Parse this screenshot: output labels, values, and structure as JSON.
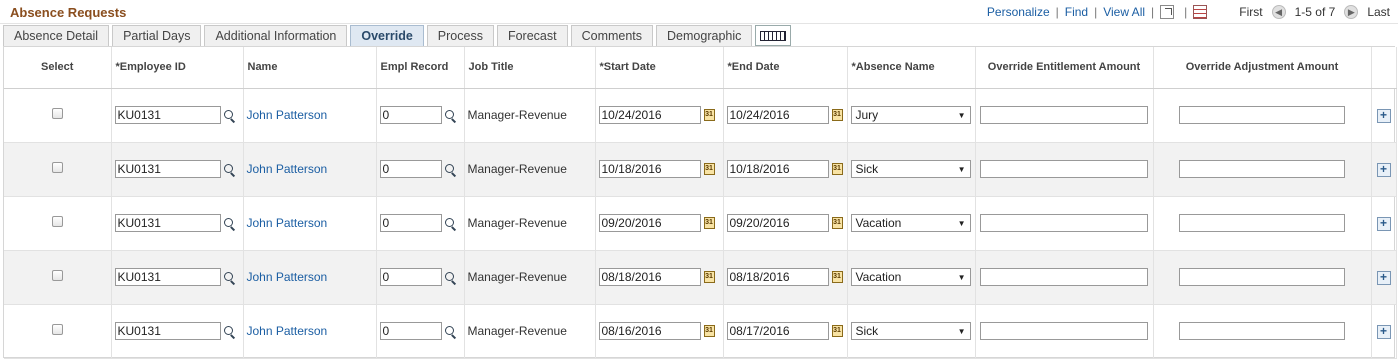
{
  "grid": {
    "title": "Absence Requests",
    "nav": {
      "personalize": "Personalize",
      "find": "Find",
      "view_all": "View All",
      "first": "First",
      "range": "1-5 of 7",
      "last": "Last"
    }
  },
  "tabs": [
    {
      "label": "Absence Detail",
      "active": false
    },
    {
      "label": "Partial Days",
      "active": false
    },
    {
      "label": "Additional Information",
      "active": false
    },
    {
      "label": "Override",
      "active": true
    },
    {
      "label": "Process",
      "active": false
    },
    {
      "label": "Forecast",
      "active": false
    },
    {
      "label": "Comments",
      "active": false
    },
    {
      "label": "Demographic",
      "active": false
    }
  ],
  "columns": {
    "select": "Select",
    "employee_id": "*Employee ID",
    "name": "Name",
    "empl_record": "Empl Record",
    "job_title": "Job Title",
    "start_date": "*Start Date",
    "end_date": "*End Date",
    "absence_name": "*Absence Name",
    "override_entitlement": "Override Entitlement Amount",
    "override_adjustment": "Override Adjustment Amount"
  },
  "rows": [
    {
      "employee_id": "KU0131",
      "name": "John Patterson",
      "empl_record": "0",
      "job_title": "Manager-Revenue",
      "start_date": "10/24/2016",
      "end_date": "10/24/2016",
      "absence_name": "Jury",
      "entitlement": "",
      "adjustment": ""
    },
    {
      "employee_id": "KU0131",
      "name": "John Patterson",
      "empl_record": "0",
      "job_title": "Manager-Revenue",
      "start_date": "10/18/2016",
      "end_date": "10/18/2016",
      "absence_name": "Sick",
      "entitlement": "",
      "adjustment": ""
    },
    {
      "employee_id": "KU0131",
      "name": "John Patterson",
      "empl_record": "0",
      "job_title": "Manager-Revenue",
      "start_date": "09/20/2016",
      "end_date": "09/20/2016",
      "absence_name": "Vacation",
      "entitlement": "",
      "adjustment": ""
    },
    {
      "employee_id": "KU0131",
      "name": "John Patterson",
      "empl_record": "0",
      "job_title": "Manager-Revenue",
      "start_date": "08/18/2016",
      "end_date": "08/18/2016",
      "absence_name": "Vacation",
      "entitlement": "",
      "adjustment": ""
    },
    {
      "employee_id": "KU0131",
      "name": "John Patterson",
      "empl_record": "0",
      "job_title": "Manager-Revenue",
      "start_date": "08/16/2016",
      "end_date": "08/17/2016",
      "absence_name": "Sick",
      "entitlement": "",
      "adjustment": ""
    }
  ],
  "icons": {
    "lookup": "magnifier-icon",
    "calendar": "calendar-icon",
    "calendar_glyph": "31",
    "dropdown_glyph": "▼",
    "add_glyph": "+",
    "first_glyph": "◀",
    "last_glyph": "▶"
  },
  "colors": {
    "title": "#8a4e1e",
    "link": "#1b5ea3",
    "active_tab": "#dfe8f2",
    "alt_row": "#f2f2f2"
  }
}
